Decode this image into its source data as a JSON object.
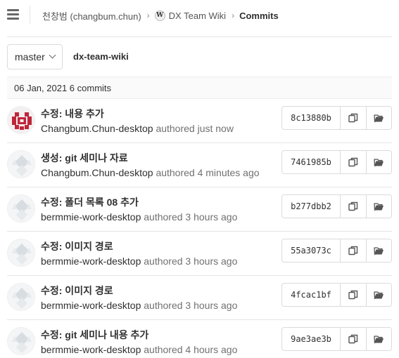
{
  "breadcrumb": {
    "user": "천창범 (changbum.chun)",
    "project_icon": "W",
    "project": "DX Team Wiki",
    "current": "Commits"
  },
  "branch": {
    "selected": "master"
  },
  "project_name": "dx-team-wiki",
  "day_group": {
    "label": "06 Jan, 2021 6 commits"
  },
  "commits": [
    {
      "title": "수정: 내용 추가",
      "author": "Changbum.Chun-desktop",
      "when": "authored just now",
      "sha": "8c13880b",
      "avatar": "identicon-red"
    },
    {
      "title": "생성: git 세미나 자료",
      "author": "Changbum.Chun-desktop",
      "when": "authored 4 minutes ago",
      "sha": "7461985b",
      "avatar": "default-grey"
    },
    {
      "title": "수정: 폴더 목록 08 추가",
      "author": "bermmie-work-desktop",
      "when": "authored 3 hours ago",
      "sha": "b277dbb2",
      "avatar": "default-grey"
    },
    {
      "title": "수정: 이미지 경로",
      "author": "bermmie-work-desktop",
      "when": "authored 3 hours ago",
      "sha": "55a3073c",
      "avatar": "default-grey"
    },
    {
      "title": "수정: 이미지 경로",
      "author": "bermmie-work-desktop",
      "when": "authored 3 hours ago",
      "sha": "4fcac1bf",
      "avatar": "default-grey"
    },
    {
      "title": "수정: git 세미나 내용 추가",
      "author": "bermmie-work-desktop",
      "when": "authored 4 hours ago",
      "sha": "9ae3ae3b",
      "avatar": "default-grey"
    }
  ],
  "icons": {
    "menu": "hamburger-icon",
    "copy": "copy-icon",
    "browse": "folder-open-icon"
  },
  "colors": {
    "avatar_red": "#c0263a",
    "avatar_grey": "#d8dde2",
    "border": "#dbdbdb"
  }
}
